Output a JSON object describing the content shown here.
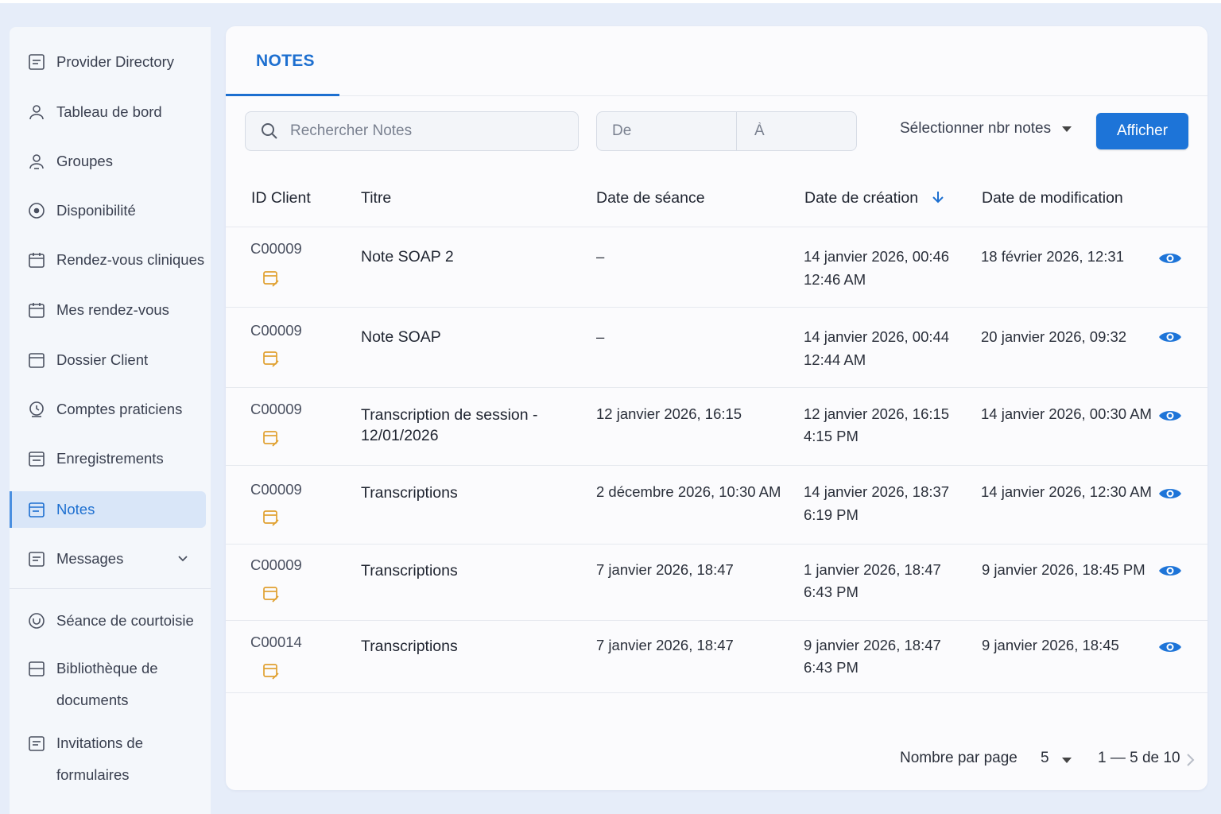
{
  "sidebar": {
    "items": [
      {
        "label": "Provider Directory",
        "icon": "list-doc-icon"
      },
      {
        "label": "Tableau de bord",
        "icon": "user-icon"
      },
      {
        "label": "Groupes",
        "icon": "group-icon"
      },
      {
        "label": "Disponibilité",
        "icon": "clock-circle-icon"
      },
      {
        "label": "Rendez-vous cliniques",
        "icon": "calendar-icon"
      },
      {
        "label": "Mes rendez-vous",
        "icon": "calendar-icon"
      },
      {
        "label": "Dossier Client",
        "icon": "folder-icon"
      },
      {
        "label": "Comptes praticiens",
        "icon": "clock-account-icon"
      },
      {
        "label": "Enregistrements",
        "icon": "records-icon"
      },
      {
        "label": "Notes",
        "icon": "notes-icon",
        "active": true
      },
      {
        "label": "Messages",
        "icon": "message-icon",
        "expandable": true
      },
      {
        "label": "Séance de courtoisie",
        "icon": "courtesy-icon"
      },
      {
        "label": "Bibliothèque de documents",
        "icon": "library-icon"
      },
      {
        "label": "Invitations de formulaires",
        "icon": "form-invite-icon"
      }
    ]
  },
  "tabs": {
    "active": "NOTES"
  },
  "filters": {
    "search_placeholder": "Rechercher Notes",
    "date_from_placeholder": "De",
    "date_to_placeholder": "À",
    "select_count_label": "Sélectionner nbr notes",
    "submit_label": "Afficher"
  },
  "table": {
    "columns": [
      "ID Client",
      "Titre",
      "Date de séance",
      "Date de création",
      "Date de modification"
    ],
    "sort_column": "Date de création",
    "sort_direction": "desc",
    "rows": [
      {
        "client_id": "C00009",
        "title": "Note SOAP 2",
        "session_date": "–",
        "created_line1": "14 janvier 2026, 00:46",
        "created_line2": "12:46 AM",
        "modified": "18 février 2026, 12:31"
      },
      {
        "client_id": "C00009",
        "title": "Note SOAP",
        "session_date": "–",
        "created_line1": "14 janvier 2026, 00:44",
        "created_line2": "12:44 AM",
        "modified": "20 janvier 2026, 09:32"
      },
      {
        "client_id": "C00009",
        "title": "Transcription de session - 12/01/2026",
        "session_date": "12 janvier 2026, 16:15",
        "created_line1": "12 janvier 2026, 16:15",
        "created_line2": "4:15 PM",
        "modified": "14 janvier 2026, 00:30 AM"
      },
      {
        "client_id": "C00009",
        "title": "Transcriptions",
        "session_date": "2 décembre 2026, 10:30 AM",
        "created_line1": "14 janvier 2026, 18:37",
        "created_line2": "6:19 PM",
        "modified": "14 janvier 2026, 12:30 AM"
      },
      {
        "client_id": "C00009",
        "title": "Transcriptions",
        "session_date": "7 janvier 2026, 18:47",
        "created_line1": "1 janvier 2026, 18:47",
        "created_line2": "6:43 PM",
        "modified": "9 janvier 2026, 18:45 PM"
      },
      {
        "client_id": "C00014",
        "title": "Transcriptions",
        "session_date": "7 janvier 2026, 18:47",
        "created_line1": "9 janvier 2026, 18:47",
        "created_line2": "6:43 PM",
        "modified": "9 janvier 2026, 18:45"
      }
    ]
  },
  "pagination": {
    "per_page_label": "Nombre par page",
    "per_page_value": "5",
    "range_label": "1 — 5 de 10"
  },
  "colors": {
    "accent": "#1d6fd0",
    "button": "#1d74d8",
    "note_icon": "#e0a030",
    "background": "#e6edf9"
  }
}
